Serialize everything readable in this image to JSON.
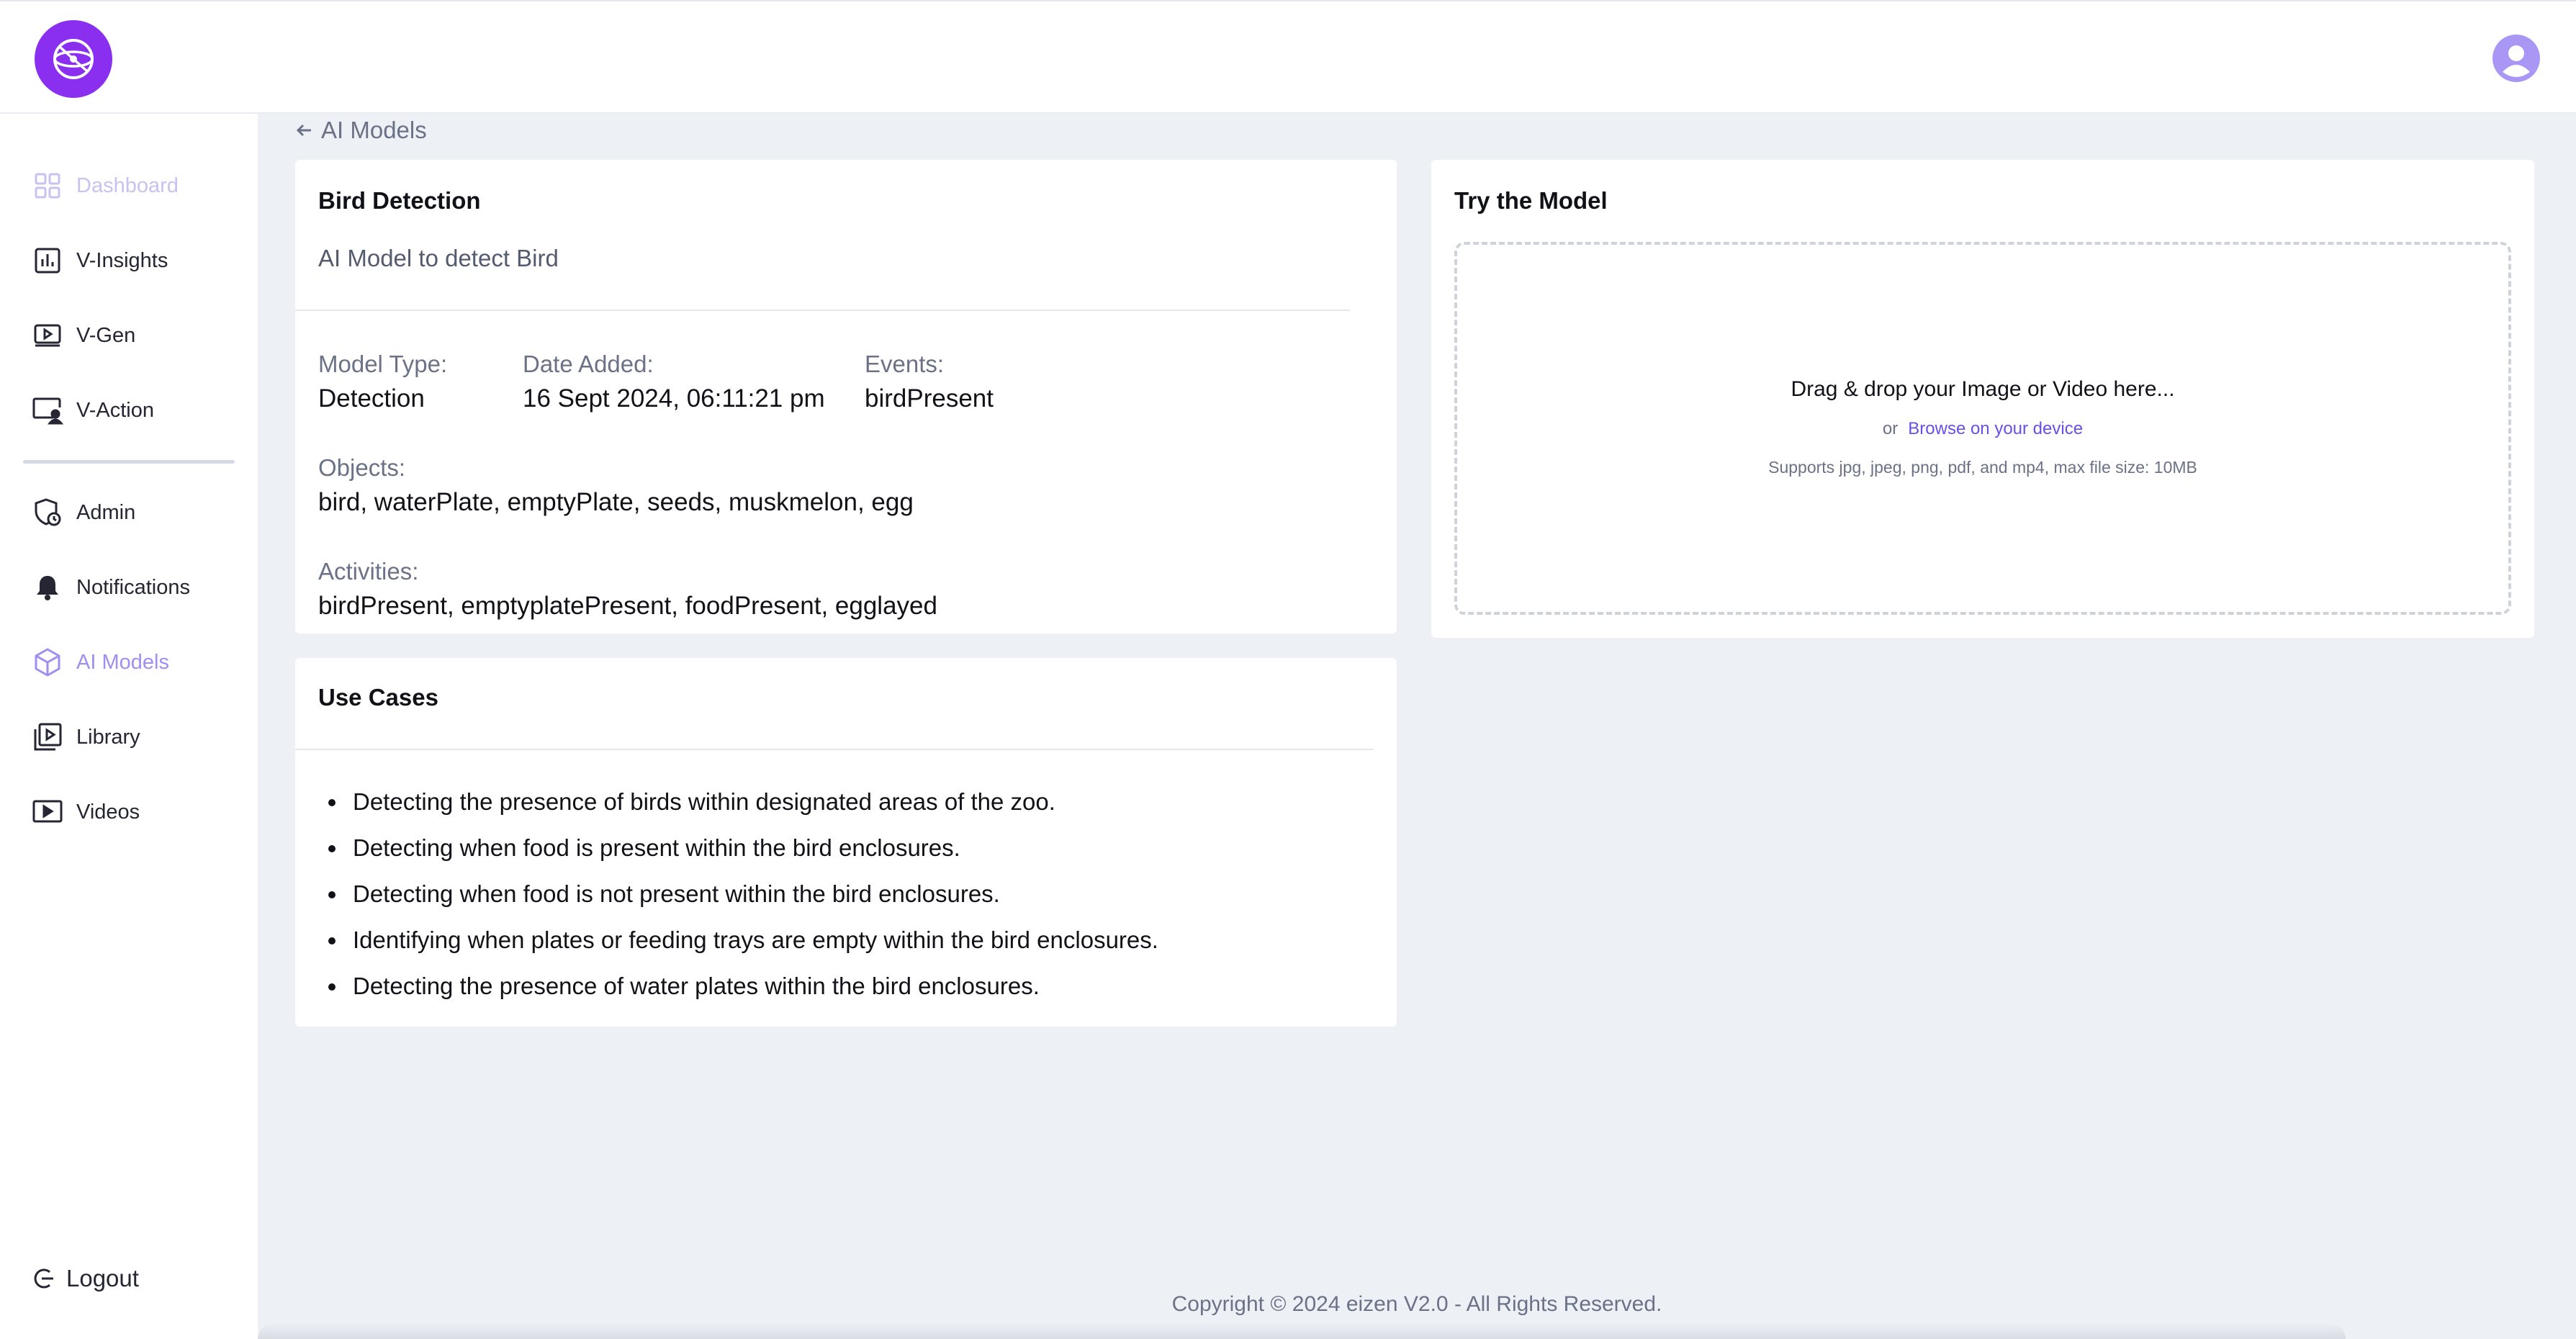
{
  "sidebar": {
    "items": [
      {
        "label": "Dashboard",
        "icon": "grid-icon"
      },
      {
        "label": "V-Insights",
        "icon": "bar-chart-icon"
      },
      {
        "label": "V-Gen",
        "icon": "play-screen-icon"
      },
      {
        "label": "V-Action",
        "icon": "monitor-user-icon"
      },
      {
        "label": "Admin",
        "icon": "shield-clock-icon"
      },
      {
        "label": "Notifications",
        "icon": "bell-icon"
      },
      {
        "label": "AI Models",
        "icon": "cube-icon"
      },
      {
        "label": "Library",
        "icon": "library-play-icon"
      },
      {
        "label": "Videos",
        "icon": "video-play-icon"
      }
    ],
    "logout_label": "Logout"
  },
  "breadcrumb": {
    "back_label": "AI Models"
  },
  "model": {
    "title": "Bird Detection",
    "description": "AI Model to detect Bird",
    "model_type_label": "Model Type:",
    "model_type": "Detection",
    "date_added_label": "Date Added:",
    "date_added": "16 Sept 2024, 06:11:21 pm",
    "events_label": "Events:",
    "events": "birdPresent",
    "objects_label": "Objects:",
    "objects": "bird, waterPlate, emptyPlate, seeds, muskmelon, egg",
    "activities_label": "Activities:",
    "activities": "birdPresent, emptyplatePresent, foodPresent, egglayed"
  },
  "use_cases": {
    "title": "Use Cases",
    "items": [
      "Detecting the presence of birds within designated areas of the zoo.",
      "Detecting when food is present within the bird enclosures.",
      "Detecting when food is not present within the bird enclosures.",
      "Identifying when plates or feeding trays are empty within the bird enclosures.",
      "Detecting the presence of water plates within the bird enclosures."
    ]
  },
  "try_model": {
    "title": "Try the Model",
    "drop_text": "Drag & drop your Image or Video here...",
    "or_text": "or",
    "browse_link": "Browse on your device",
    "supports_text": "Supports jpg, jpeg, png, pdf, and mp4, max file size: 10MB"
  },
  "footer": {
    "copyright": "Copyright © 2024 eizen V2.0 - All Rights Reserved."
  },
  "colors": {
    "brand": "#8a2ef0",
    "accent": "#a08ef0",
    "link": "#6a4ee8",
    "background": "#edf0f5"
  }
}
